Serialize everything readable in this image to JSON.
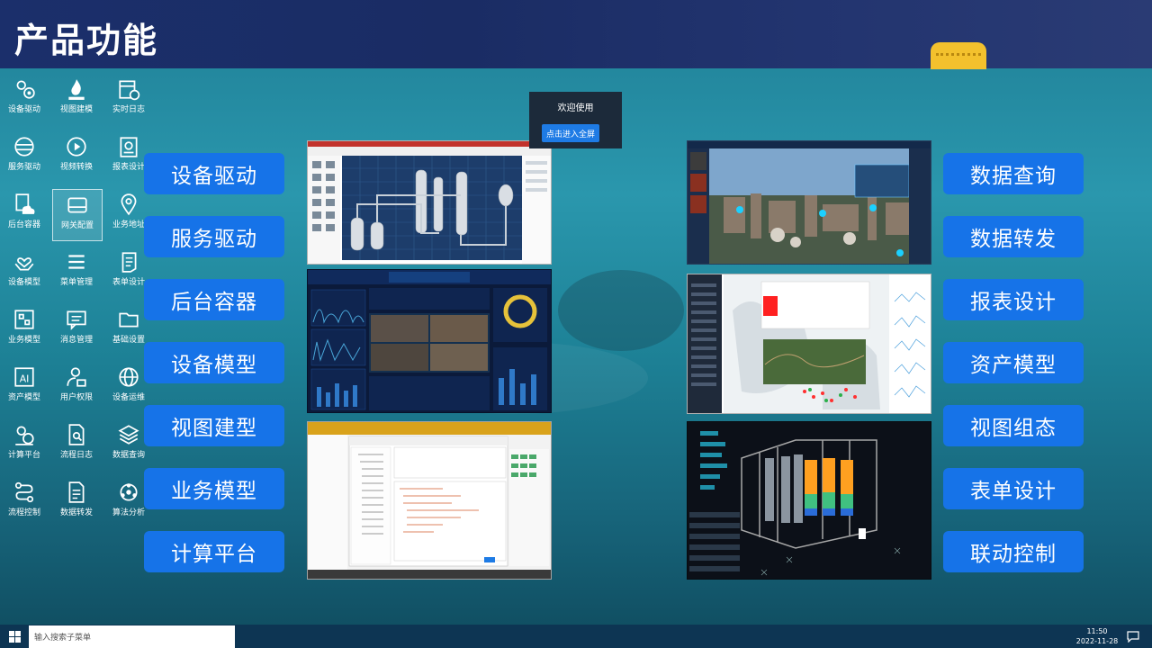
{
  "page": {
    "title": "产品功能"
  },
  "left_icons": [
    {
      "label": "设备驱动",
      "icon": "settings-gears-icon"
    },
    {
      "label": "视图建模",
      "icon": "flame-icon"
    },
    {
      "label": "实时日志",
      "icon": "calendar-clock-icon"
    },
    {
      "label": "服务驱动",
      "icon": "server-icon"
    },
    {
      "label": "视频转换",
      "icon": "video-play-icon"
    },
    {
      "label": "报表设计",
      "icon": "report-icon"
    },
    {
      "label": "后台容器",
      "icon": "cloud-doc-icon"
    },
    {
      "label": "网关配置",
      "icon": "gateway-drive-icon"
    },
    {
      "label": "业务地址",
      "icon": "location-pin-icon"
    },
    {
      "label": "设备模型",
      "icon": "hands-heart-icon"
    },
    {
      "label": "菜单管理",
      "icon": "list-icon"
    },
    {
      "label": "表单设计",
      "icon": "form-scroll-icon"
    },
    {
      "label": "业务模型",
      "icon": "grid-box-icon"
    },
    {
      "label": "消息管理",
      "icon": "message-icon"
    },
    {
      "label": "基础设置",
      "icon": "folder-icon"
    },
    {
      "label": "资产模型",
      "icon": "ai-box-icon"
    },
    {
      "label": "用户权限",
      "icon": "user-lock-icon"
    },
    {
      "label": "设备运维",
      "icon": "globe-gear-icon"
    },
    {
      "label": "计算平台",
      "icon": "compute-gear-icon"
    },
    {
      "label": "流程日志",
      "icon": "doc-search-icon"
    },
    {
      "label": "数据查询",
      "icon": "layers-icon"
    },
    {
      "label": "流程控制",
      "icon": "flow-path-icon"
    },
    {
      "label": "数据转发",
      "icon": "doc-forward-icon"
    },
    {
      "label": "算法分析",
      "icon": "algorithm-icon"
    }
  ],
  "left_features": [
    "设备驱动",
    "服务驱动",
    "后台容器",
    "设备模型",
    "视图建型",
    "业务模型",
    "计算平台"
  ],
  "right_features": [
    "数据查询",
    "数据转发",
    "报表设计",
    "资产模型",
    "视图组态",
    "表单设计",
    "联动控制"
  ],
  "welcome": {
    "title": "欢迎使用",
    "button": "点击进入全屏"
  },
  "taskbar": {
    "search_placeholder": "输入搜索子菜单",
    "time": "11:50",
    "date": "2022-11-28"
  },
  "colors": {
    "feature_button": "#1673e8",
    "topbar": "#1b2f6b",
    "taskbar": "#0d3553"
  }
}
